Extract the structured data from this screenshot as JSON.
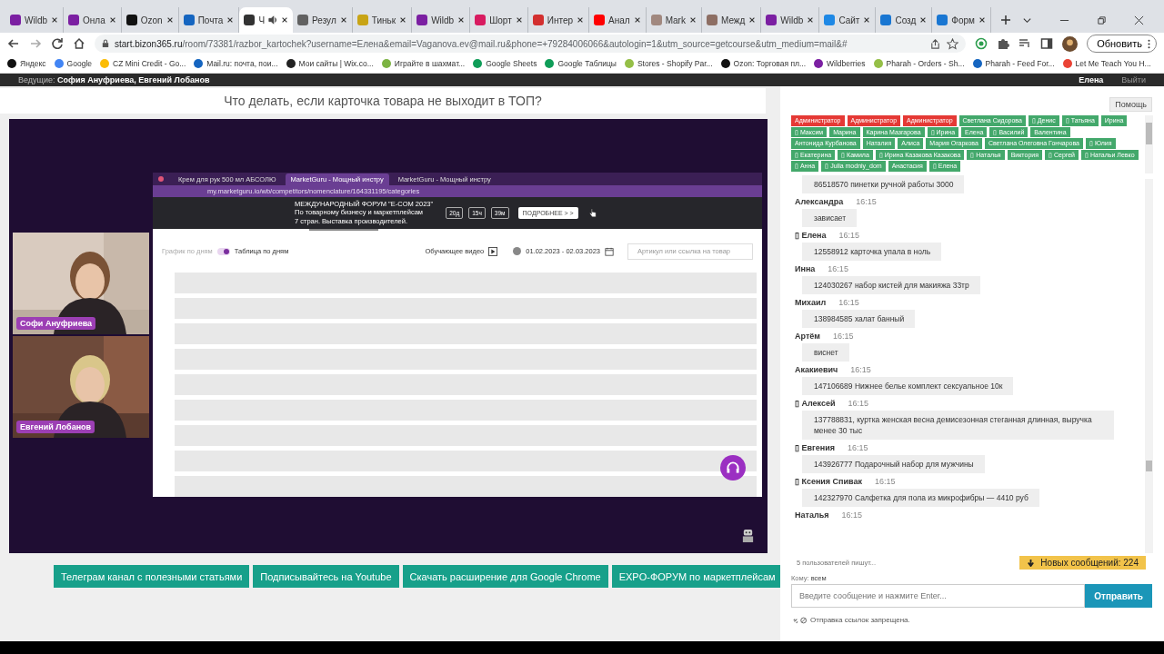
{
  "browser": {
    "tabs": [
      {
        "title": "Wildb",
        "color": "#7b1fa2",
        "selected": false
      },
      {
        "title": "Онла",
        "color": "#7b1fa2",
        "selected": false
      },
      {
        "title": "Ozon",
        "color": "#111111",
        "selected": false
      },
      {
        "title": "Почта",
        "color": "#1565c0",
        "selected": false
      },
      {
        "title": "Ч",
        "color": "#333333",
        "selected": true,
        "audio": true
      },
      {
        "title": "Резул",
        "color": "#616161",
        "selected": false
      },
      {
        "title": "Тиньк",
        "color": "#c8a415",
        "selected": false
      },
      {
        "title": "Wildb",
        "color": "#7b1fa2",
        "selected": false
      },
      {
        "title": "Шорт",
        "color": "#d81b60",
        "selected": false
      },
      {
        "title": "Интер",
        "color": "#d32f2f",
        "selected": false
      },
      {
        "title": "Анал",
        "color": "#ff0000",
        "selected": false
      },
      {
        "title": "Mark",
        "color": "#a1887f",
        "selected": false
      },
      {
        "title": "Межд",
        "color": "#8d6e63",
        "selected": false
      },
      {
        "title": "Wildb",
        "color": "#7b1fa2",
        "selected": false
      },
      {
        "title": "Сайт",
        "color": "#1e88e5",
        "selected": false
      },
      {
        "title": "Созд",
        "color": "#1976d2",
        "selected": false
      },
      {
        "title": "Форм",
        "color": "#1976d2",
        "selected": false
      }
    ],
    "url_host": "start.bizon365.ru",
    "url_path": "/room/73381/razbor_kartochek?username=Елена&email=Vaganova.ev@mail.ru&phone=+79284006066&autologin=1&utm_source=getcourse&utm_medium=mail&#",
    "update_button": "Обновить",
    "bookmarks": [
      {
        "title": "Яндекс",
        "color": "#111111"
      },
      {
        "title": "Google",
        "color": "#4285f4"
      },
      {
        "title": "CZ Mini Credit - Go...",
        "color": "#fbbc04"
      },
      {
        "title": "Mail.ru: почта, пои...",
        "color": "#1565c0"
      },
      {
        "title": "Мои сайты | Wix.co...",
        "color": "#222222"
      },
      {
        "title": "Играйте в шахмат...",
        "color": "#7cb342"
      },
      {
        "title": "Google Sheets",
        "color": "#0f9d58"
      },
      {
        "title": "Google Таблицы",
        "color": "#0f9d58"
      },
      {
        "title": "Stores - Shopify Par...",
        "color": "#95bf47"
      },
      {
        "title": "Ozon: Торговая пл...",
        "color": "#111111"
      },
      {
        "title": "Wildberries",
        "color": "#7b1fa2"
      },
      {
        "title": "Pharah - Orders - Sh...",
        "color": "#95bf47"
      },
      {
        "title": "Pharah - Feed For...",
        "color": "#1565c0"
      },
      {
        "title": "Let Me Teach You H...",
        "color": "#ea4335"
      }
    ]
  },
  "room": {
    "hosts_label": "Ведущие:",
    "hosts": "София Ануфриева, Евгений Лобанов",
    "user": "Елена",
    "logout": "Выйти",
    "title": "Что делать, если карточка товара не выходит в ТОП?",
    "webcams": [
      {
        "name": "Софи Ануфриева"
      },
      {
        "name": "Евгений Лобанов"
      }
    ],
    "shared_screen": {
      "tabs": [
        {
          "title": "Крем для рук 500 мл АБСОЛЮ",
          "selected": false
        },
        {
          "title": "MarketGuru - Мощный инстру",
          "selected": true
        },
        {
          "title": "MarketGuru - Мощный инстру",
          "selected": false
        }
      ],
      "url": "my.marketguru.io/wb/competitors/nomenclature/164331195/categories",
      "banner_lines": [
        "МЕЖДУНАРОДНЫЙ ФОРУМ \"E-COM 2023\"",
        "По товарному бизнесу и маркетплейсам",
        "7 стран. Выставка производителей."
      ],
      "countdown": [
        "20д",
        "15ч",
        "39м"
      ],
      "banner_button": "ПОДРОБНЕЕ > >",
      "toggle_left": "График по дням",
      "toggle_right": "Таблица по дням",
      "toggle_on": true,
      "video_link": "Обучающее видео",
      "date_range": "01.02.2023 - 02.03.2023",
      "search_placeholder": "Артикул или ссылка на товар"
    },
    "buttons": [
      "Телеграм канал с полезными статьями",
      "Подписывайтесь на Youtube",
      "Скачать расширение для Google Chrome",
      "EXPO-ФОРУМ по маркетплейсам"
    ]
  },
  "chat": {
    "help": "Помощь",
    "users": [
      {
        "name": "Администратор",
        "color": "#e53935"
      },
      {
        "name": "Администратор",
        "color": "#e53935"
      },
      {
        "name": "Администратор",
        "color": "#e53935"
      },
      {
        "name": "Светлана Сидорова",
        "color": "#43a86b"
      },
      {
        "name": "▯ Денис",
        "color": "#43a86b"
      },
      {
        "name": "▯ Татьяна",
        "color": "#43a86b"
      },
      {
        "name": "Ирина",
        "color": "#43a86b"
      },
      {
        "name": "▯ Максим",
        "color": "#43a86b"
      },
      {
        "name": "Марина",
        "color": "#43a86b"
      },
      {
        "name": "Карина Мазгарова",
        "color": "#43a86b"
      },
      {
        "name": "▯ Ирина",
        "color": "#43a86b"
      },
      {
        "name": "Елена",
        "color": "#43a86b"
      },
      {
        "name": "▯ Василий",
        "color": "#43a86b"
      },
      {
        "name": "Валентина",
        "color": "#43a86b"
      },
      {
        "name": "Антонида Курбанова",
        "color": "#43a86b"
      },
      {
        "name": "Наталия",
        "color": "#43a86b"
      },
      {
        "name": "Алиса",
        "color": "#43a86b"
      },
      {
        "name": "Мария Огаркова",
        "color": "#43a86b"
      },
      {
        "name": "Светлана Олеговна Гончарова",
        "color": "#43a86b"
      },
      {
        "name": "▯ Юлия",
        "color": "#43a86b"
      },
      {
        "name": "▯ Екатерина",
        "color": "#43a86b"
      },
      {
        "name": "▯ Камила",
        "color": "#43a86b"
      },
      {
        "name": "▯ Ирина Казакова Казакова",
        "color": "#43a86b"
      },
      {
        "name": "▯ Наталья",
        "color": "#43a86b"
      },
      {
        "name": "Виктория",
        "color": "#43a86b"
      },
      {
        "name": "▯ Сергей",
        "color": "#43a86b"
      },
      {
        "name": "▯ Натальи Левко",
        "color": "#43a86b"
      },
      {
        "name": "▯ Анна",
        "color": "#43a86b"
      },
      {
        "name": "▯ Julia modniy_dom",
        "color": "#43a86b"
      },
      {
        "name": "Анастасия",
        "color": "#43a86b"
      },
      {
        "name": "▯ Елена",
        "color": "#43a86b"
      }
    ],
    "messages": [
      {
        "text": "86518570 пинетки ручной работы 3000"
      },
      {
        "author": "Александра",
        "time": "16:15",
        "text": "зависает"
      },
      {
        "author": "▯ Елена",
        "time": "16:15",
        "text": "12558912 карточка упала в ноль"
      },
      {
        "author": "Инна",
        "time": "16:15",
        "text": "124030267 набор кистей для макияжа 33тр"
      },
      {
        "author": "Михаил",
        "time": "16:15",
        "text": "138984585 халат банный"
      },
      {
        "author": "Артём",
        "time": "16:15",
        "text": "виснет"
      },
      {
        "author": "Акакиевич",
        "time": "16:15",
        "text": "147106689 Нижнее белье комплект сексуальное 10к"
      },
      {
        "author": "▯ Алексей",
        "time": "16:15",
        "text": "137788831, куртка женская весна демисезонная стеганная длинная, выручка менее 30 тыс"
      },
      {
        "author": "▯ Евгения",
        "time": "16:15",
        "text": "143926777 Подарочный набор для мужчины"
      },
      {
        "author": "▯ Ксения Спивак",
        "time": "16:15",
        "text": "142327970 Салфетка для пола из микрофибры — 4410 руб"
      },
      {
        "author": "Наталья",
        "time": "16:15"
      }
    ],
    "typing": "5 пользователей пишут...",
    "new_messages": "Новых сообщений: 224",
    "to_label": "Кому:",
    "to_value": "всем",
    "input_placeholder": "Введите сообщение и нажмите Enter...",
    "send": "Отправить",
    "links_notice": "Отправка ссылок запрещена."
  }
}
